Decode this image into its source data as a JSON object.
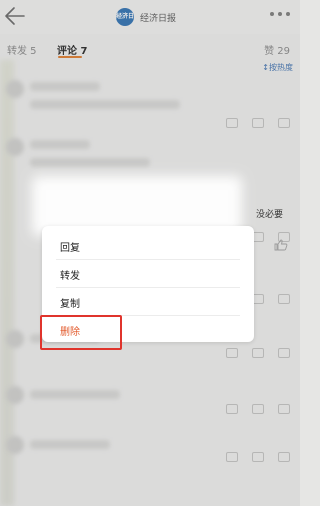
{
  "header": {
    "account_name": "经济日报",
    "avatar_text": "经济日报",
    "icons": {
      "back": "back-arrow-icon",
      "more": "more-dots-icon"
    }
  },
  "tabs": {
    "repost": "转发 5",
    "comment": "评论 7",
    "likes": "赞 29"
  },
  "sort_toggle": "↕按热度",
  "preview": {
    "visible_fragment": "没必要"
  },
  "menu": {
    "items": [
      {
        "label": "回复"
      },
      {
        "label": "转发"
      },
      {
        "label": "复制"
      },
      {
        "label": "删除"
      }
    ]
  },
  "colors": {
    "accent_orange": "#e07a2a",
    "delete_red": "#e2592b",
    "highlight_red": "#e0342c",
    "link_blue": "#3b6fb0"
  }
}
